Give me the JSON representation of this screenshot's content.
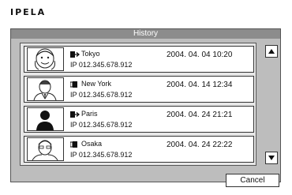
{
  "app": {
    "logo_text": "IPELA"
  },
  "dialog": {
    "title": "History",
    "cancel_label": "Cancel",
    "entries": [
      {
        "place": "Tokyo",
        "ip": "IP 012.345.678.912",
        "datetime": "2004. 04. 04 10:20",
        "direction_icon": "outgoing-call-icon",
        "thumbnail": "smiling-person"
      },
      {
        "place": "New York",
        "ip": "IP 012.345.678.912",
        "datetime": "2004. 04. 14 12:34",
        "direction_icon": "incoming-call-icon",
        "thumbnail": "man-in-suit"
      },
      {
        "place": "Paris",
        "ip": "IP 012.345.678.912",
        "datetime": "2004. 04. 24 21:21",
        "direction_icon": "outgoing-call-icon",
        "thumbnail": "silhouette"
      },
      {
        "place": "Osaka",
        "ip": "IP 012.345.678.912",
        "datetime": "2004. 04. 24 22:22",
        "direction_icon": "incoming-call-icon",
        "thumbnail": "man-with-glasses"
      }
    ]
  }
}
